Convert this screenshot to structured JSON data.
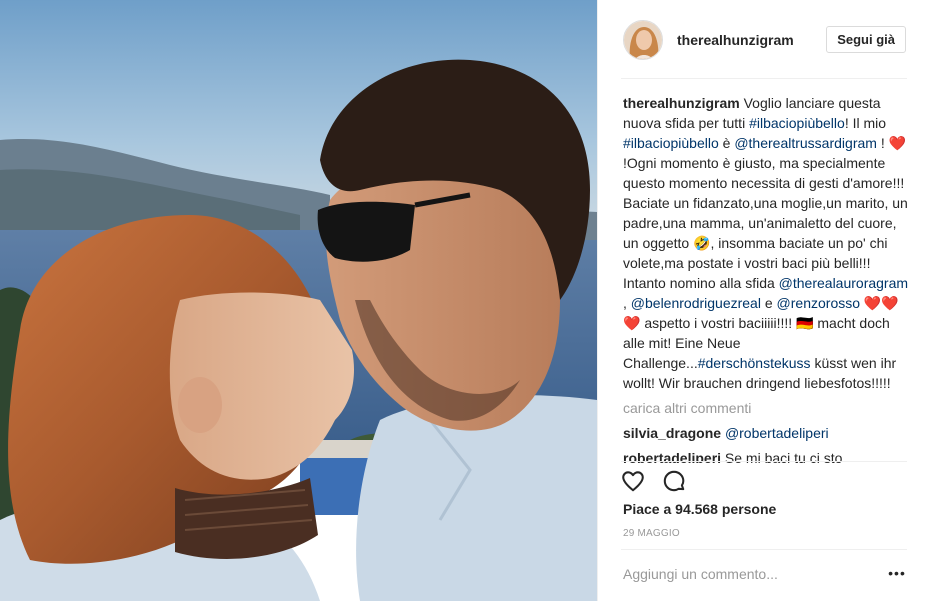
{
  "post": {
    "username": "therealhunzigram",
    "follow_label": "Segui già",
    "caption": {
      "t1": "Voglio lanciare questa nuova sfida per tutti ",
      "tag1": "#ilbaciopiùbello",
      "t2": "! Il mio ",
      "tag2": "#ilbaciopiùbello",
      "t3": " è ",
      "mention1": "@therealtrussardigram",
      "t4": " ! ",
      "heart1": "❤️",
      "t5": " !Ogni momento è giusto, ma specialmente questo momento necessita di gesti d'amore!!! Baciate un fidanzato,una moglie,un marito, un padre,una mamma, un'animaletto del cuore, un oggetto ",
      "emoji_laugh": "🤣",
      "t6": ", insomma baciate un po' chi volete,ma postate i vostri baci più belli!!! Intanto nomino alla sfida ",
      "mention2": "@therealauroragram",
      "t7": " , ",
      "mention3": "@belenrodriguezreal",
      "t8": " e ",
      "mention4": "@renzorosso",
      "t9": " ",
      "hearts": "❤️❤️❤️",
      "t10": " aspetto i vostri baciiiii!!!! ",
      "flag": "🇩🇪",
      "t11": " macht doch alle mit! Eine Neue Challenge...",
      "tag3": "#derschönstekuss",
      "t12": " küsst wen ihr wollt! Wir brauchen dringend liebesfotos!!!!!"
    },
    "load_more": "carica altri commenti",
    "comments": [
      {
        "user": "silvia_dragone",
        "text": "@robertadeliperi"
      },
      {
        "user": "robertadeliperi",
        "text": "Se mi baci tu ci sto"
      }
    ],
    "likes": "Piace a 94.568 persone",
    "date": "29 MAGGIO",
    "add_comment_placeholder": "Aggiungi un commento...",
    "more_label": "•••"
  },
  "colors": {
    "link": "#003569",
    "muted": "#999999",
    "border": "#efefef",
    "text": "#262626"
  }
}
